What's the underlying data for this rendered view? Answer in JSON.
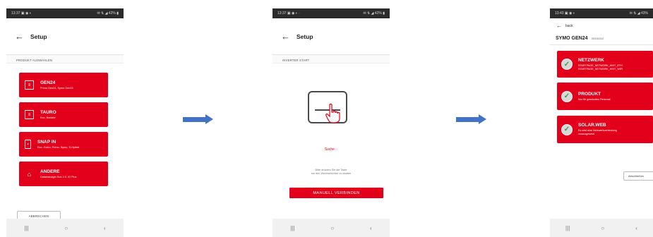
{
  "colors": {
    "accent_red": "#e3001b",
    "arrow_blue": "#4472c4",
    "check_green": "#3aa335"
  },
  "screens": [
    {
      "status": {
        "time": "13:37 ▣ ◉ ◐",
        "icons": "✉ ⇅ ◢ 42% ▮"
      },
      "title": "Setup",
      "section": "PRODUKT AUSWAHLEN",
      "cards": [
        {
          "title": "GEN24",
          "subtitle": "Primo Gen24, Symo Gen24",
          "icon": "inverter-icon"
        },
        {
          "title": "TAURO",
          "subtitle": "Eco, Booster",
          "icon": "inverter-icon"
        },
        {
          "title": "SNAP IN",
          "subtitle": "Eco, Galvo, Primo, Symo, S-Hybrid",
          "icon": "snapin-icon"
        },
        {
          "title": "ANDERE",
          "subtitle": "Datamanager Box 2.0, IG Plus",
          "icon": "router-icon"
        }
      ],
      "cancel_label": "ABBRECHEN"
    },
    {
      "status": {
        "time": "13:37 ▣ ◉ ◐ ·",
        "icons": "✉ ⇅ ◢ 42% ▮"
      },
      "title": "Setup",
      "section": "INVERTER START",
      "search_text": "Suche",
      "hint_line1": "Bitte drücken Sie die Taste",
      "hint_line2": "um den Wechselrichter zu starten",
      "manual_button": "MANUELL VERBINDEN"
    },
    {
      "status": {
        "time": "13:43 ▣ ◉ ◐",
        "icons": "✉ ⇅ ◢ 43%"
      },
      "back_label": "back",
      "device_name": "SYMO GEN24",
      "serial": "30316312",
      "cards": [
        {
          "title": "NETZWERK",
          "line1": "STARTPAGE_NETWORK_HINT_ETH",
          "line2": "STARTPAGE_NETWORK_HINT_WIFI"
        },
        {
          "title": "PRODUKT",
          "line1": "Nur für geschultes Personal",
          "line2": ""
        },
        {
          "title": "SOLAR.WEB",
          "line1": "Es wird eine Netzwerkverbindung",
          "line2": "vorausgesetzt"
        }
      ],
      "finish_button": "Abschließen"
    }
  ],
  "nav": {
    "recents": "|||",
    "home": "○",
    "back": "‹"
  }
}
